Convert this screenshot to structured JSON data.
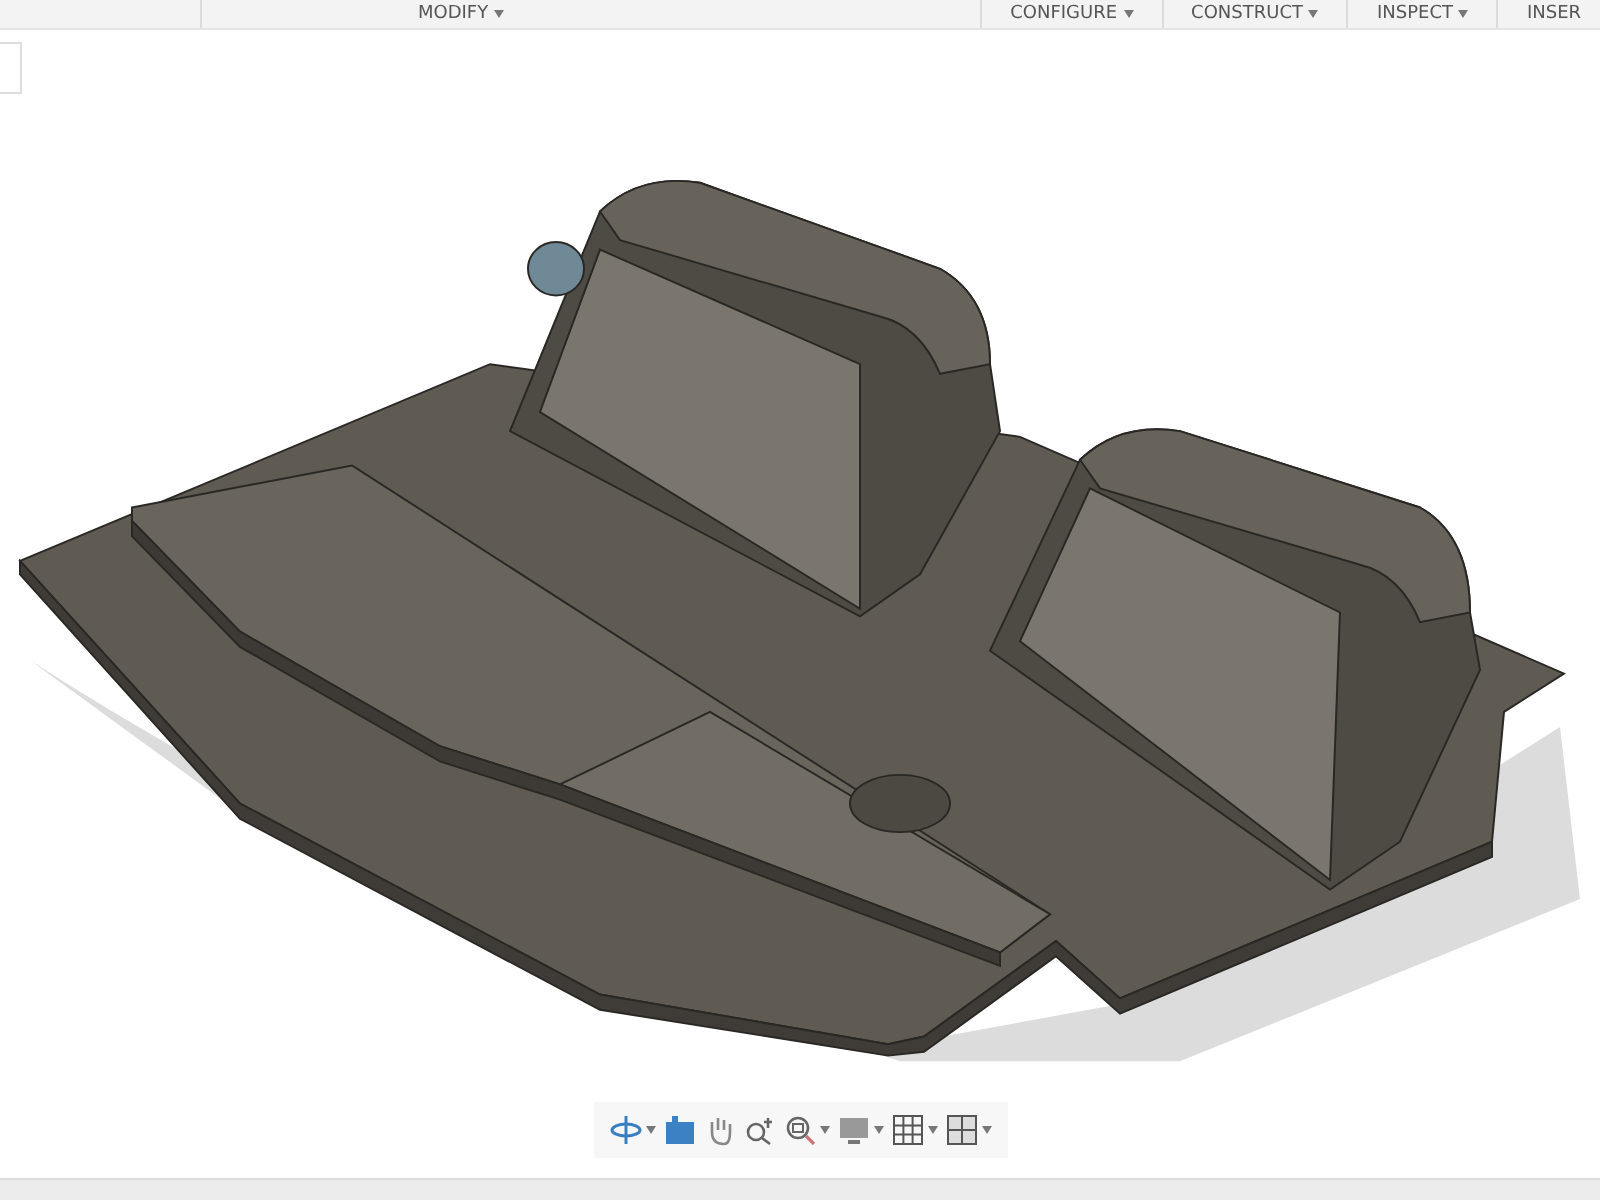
{
  "toolbar": {
    "tabs": [
      {
        "label": "MODIFY"
      },
      {
        "label": "CONFIGURE"
      },
      {
        "label": "CONSTRUCT"
      },
      {
        "label": "INSPECT"
      },
      {
        "label": "INSER"
      }
    ]
  }
}
